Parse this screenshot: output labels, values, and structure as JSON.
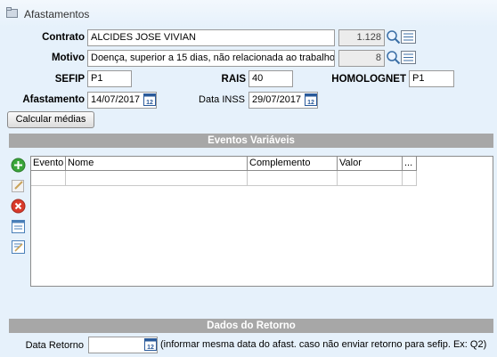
{
  "window": {
    "title": "Afastamentos"
  },
  "form": {
    "contrato_label": "Contrato",
    "contrato_value": "ALCIDES JOSE VIVIAN",
    "contrato_code": "1.128",
    "motivo_label": "Motivo",
    "motivo_value": "Doença, superior a 15 dias, não relacionada ao trabalho",
    "motivo_code": "8",
    "sefip_label": "SEFIP",
    "sefip_value": "P1",
    "rais_label": "RAIS",
    "rais_value": "40",
    "homolognet_label": "HOMOLOGNET",
    "homolognet_value": "P1",
    "afastamento_label": "Afastamento",
    "afastamento_value": "14/07/2017",
    "data_inss_label": "Data INSS",
    "data_inss_value": "29/07/2017",
    "calc_button": "Calcular médias"
  },
  "eventos": {
    "section_title": "Eventos Variáveis",
    "columns": [
      "Evento",
      "Nome",
      "Complemento",
      "Valor",
      "..."
    ]
  },
  "retorno": {
    "section_title": "Dados do Retorno",
    "data_retorno_label": "Data Retorno",
    "data_retorno_value": "",
    "hint": "(informar mesma data do afast. caso não enviar retorno para sefip. Ex: Q2)"
  },
  "icons": {
    "header": "folder-icon",
    "search": "magnifier-icon",
    "list": "list-icon",
    "calendar": "calendar-icon",
    "add": "add-icon",
    "edit": "edit-icon",
    "delete": "delete-icon",
    "copy": "copy-icon",
    "notes": "notes-icon"
  },
  "colors": {
    "background": "#e6f1fb",
    "section_bar": "#a7a7a7",
    "add_green": "#3aa53a",
    "delete_red": "#d93a2b",
    "calendar_blue": "#2a5a9a"
  }
}
